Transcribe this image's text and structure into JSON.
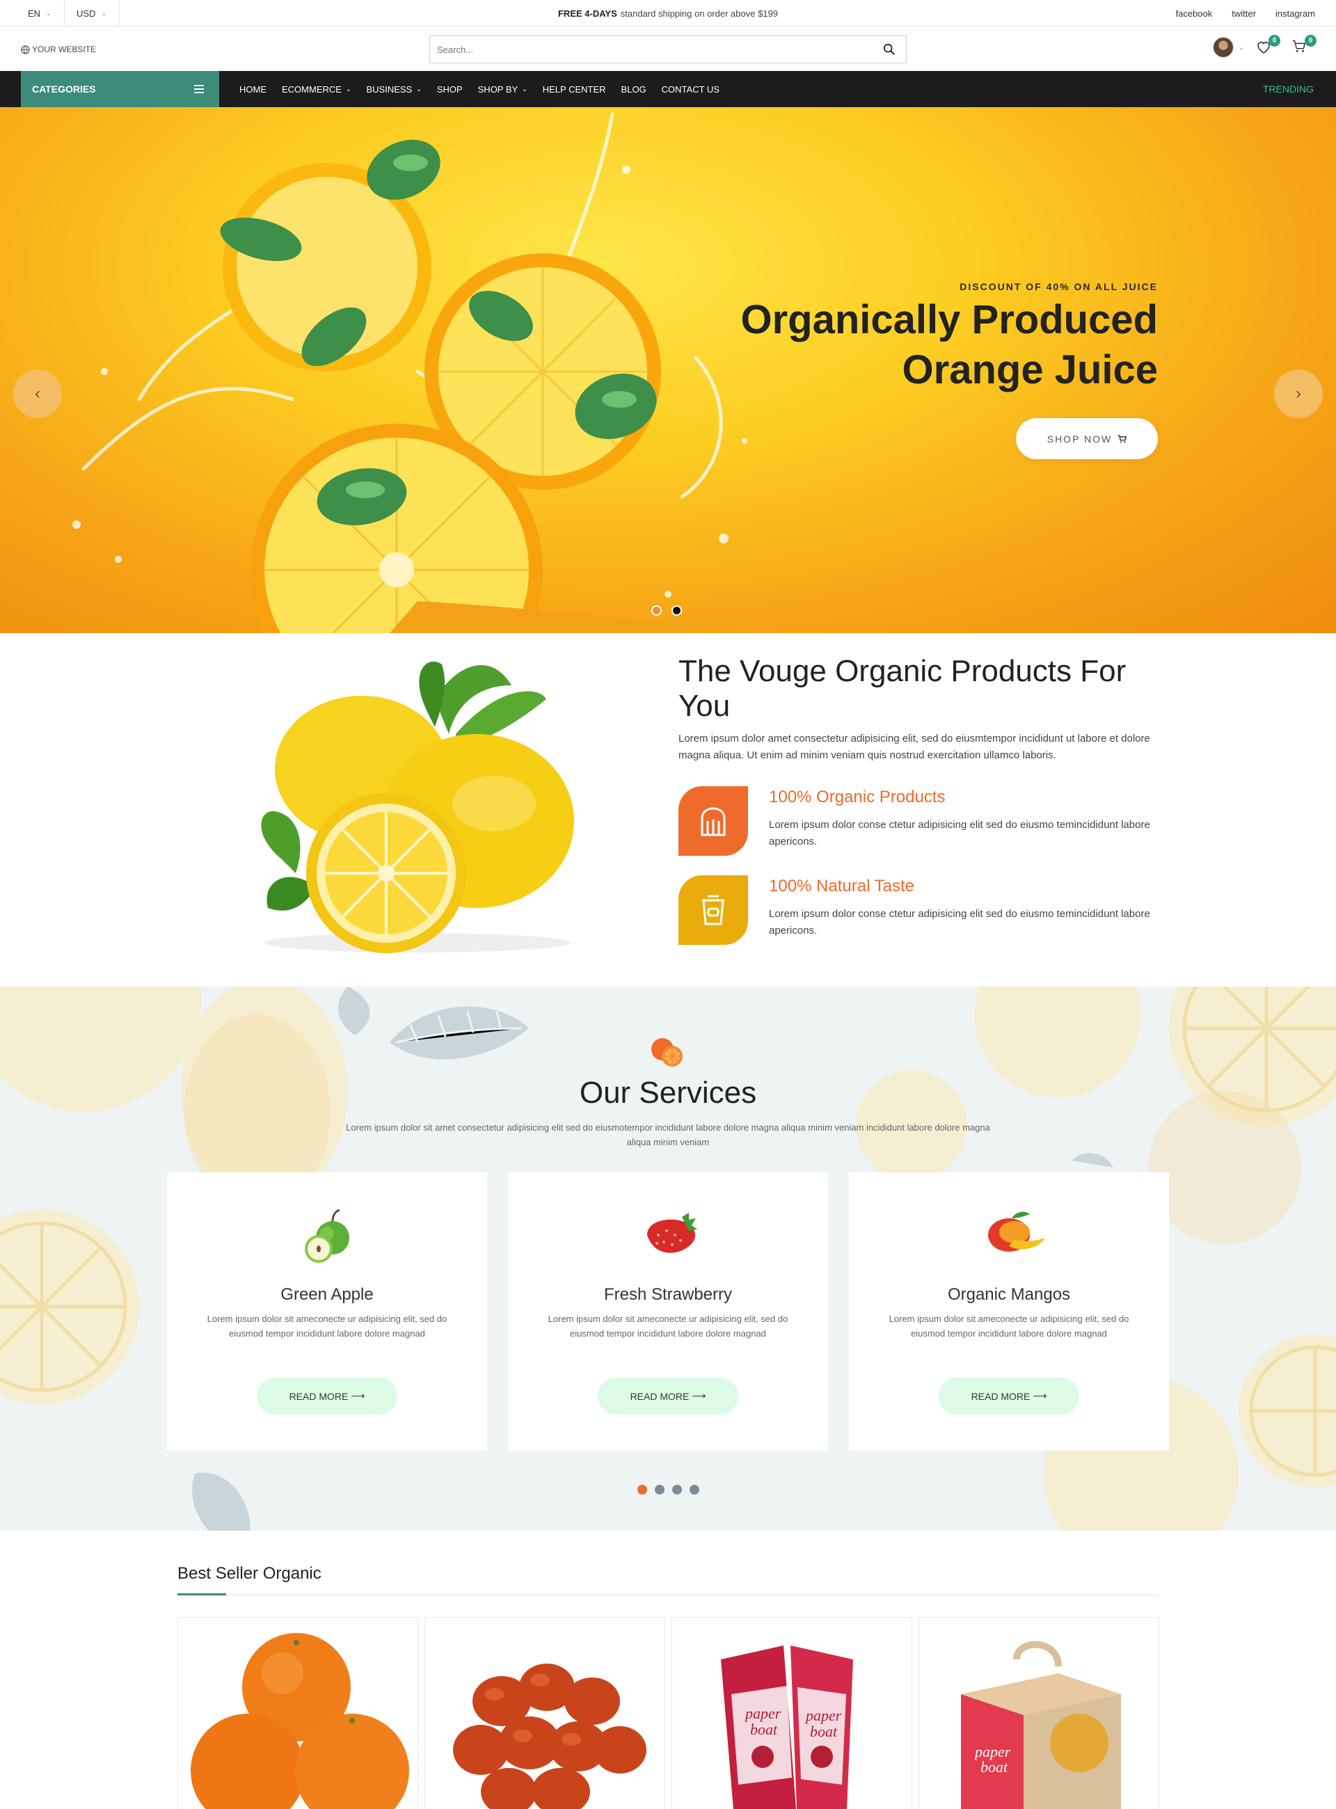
{
  "topbar": {
    "language": "EN",
    "currency": "USD",
    "promo_bold": "FREE 4-DAYS",
    "promo_text": "standard shipping on order above $199",
    "social": [
      "facebook",
      "twitter",
      "instagram"
    ]
  },
  "header": {
    "logo": "YOUR WEBSITE",
    "search_placeholder": "Search...",
    "wishlist_count": "0",
    "cart_count": "0",
    "icons": [
      "search-icon",
      "avatar",
      "chevron-down-icon",
      "heart-icon",
      "cart-icon"
    ]
  },
  "nav": {
    "categories_label": "CATEGORIES",
    "menu": [
      {
        "label": "HOME",
        "dropdown": false
      },
      {
        "label": "ECOMMERCE",
        "dropdown": true
      },
      {
        "label": "BUSINESS",
        "dropdown": true
      },
      {
        "label": "SHOP",
        "dropdown": false
      },
      {
        "label": "SHOP BY",
        "dropdown": true
      },
      {
        "label": "HELP CENTER",
        "dropdown": false
      },
      {
        "label": "BLOG",
        "dropdown": false
      },
      {
        "label": "CONTACT US",
        "dropdown": false
      }
    ],
    "trending": "TRENDING"
  },
  "hero": {
    "eyebrow": "DISCOUNT OF 40% ON ALL JUICE",
    "title_line1": "Organically Produced",
    "title_line2": "Orange Juice",
    "button": "SHOP NOW",
    "active_slide": 2,
    "slide_count": 2,
    "colors": {
      "dot_active": "#111111",
      "dot_inactive": "#f08a2a"
    }
  },
  "about": {
    "title": "The Vouge Organic Products For You",
    "description": "Lorem ipsum dolor amet consectetur adipisicing elit, sed do eiusmtempor incididunt ut labore et dolore magna aliqua. Ut enim ad minim veniam quis nostrud exercitation ullamco laboris.",
    "features": [
      {
        "title": "100% Organic Products",
        "text": "Lorem ipsum dolor conse ctetur adipisicing elit sed do eiusmo temincididunt labore apericons.",
        "color": "#ee6b2c",
        "icon": "bread-icon"
      },
      {
        "title": "100% Natural Taste",
        "text": "Lorem ipsum dolor conse ctetur adipisicing elit sed do eiusmo temincididunt labore apericons.",
        "color": "#e9ac0a",
        "icon": "cup-icon"
      }
    ]
  },
  "services": {
    "title": "Our Services",
    "subtitle": "Lorem ipsum dolor sit amet consectetur adipisicing elit sed do eiusmotempor incididunt labore dolore magna aliqua minim veniam incididunt labore dolore magna aliqua minim veniam",
    "cards": [
      {
        "title": "Green Apple",
        "text": "Lorem ipsum dolor sit ameconecte ur adipisicing elit, sed do eiusmod tempor incididunt labore dolore magnad",
        "button": "READ MORE",
        "icon": "apple-icon"
      },
      {
        "title": "Fresh Strawberry",
        "text": "Lorem ipsum dolor sit ameconecte ur adipisicing elit, sed do eiusmod tempor incididunt labore dolore magnad",
        "button": "READ MORE",
        "icon": "strawberry-icon"
      },
      {
        "title": "Organic Mangos",
        "text": "Lorem ipsum dolor sit ameconecte ur adipisicing elit, sed do eiusmod tempor incididunt labore dolore magnad",
        "button": "READ MORE",
        "icon": "mango-icon"
      }
    ],
    "active_page": 1,
    "page_count": 4
  },
  "best_seller": {
    "title": "Best Seller Organic",
    "products": [
      {
        "name": "oranges",
        "icon": "oranges-image"
      },
      {
        "name": "tomatoes",
        "icon": "tomatoes-image"
      },
      {
        "name": "paper boat anar juice",
        "icon": "juice-packs-image"
      },
      {
        "name": "paper boat gift box",
        "icon": "gift-box-image"
      }
    ]
  },
  "colors": {
    "accent": "#3c8b7b",
    "nav_bg": "#1c1c1c",
    "orange": "#ee6b2c",
    "trending": "#2fbf95"
  }
}
